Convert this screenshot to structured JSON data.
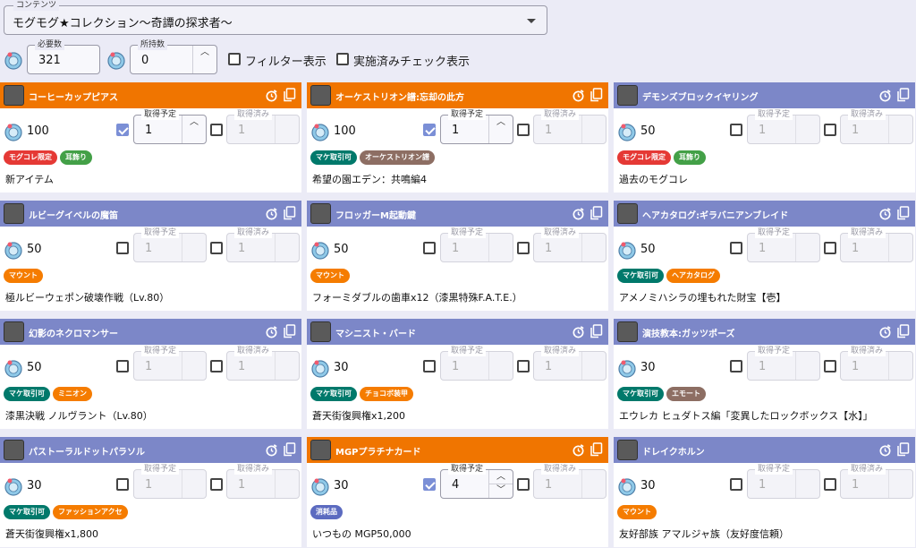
{
  "content_select": {
    "label": "コンテンツ",
    "value": "モグモグ★コレクション～奇譚の探求者～"
  },
  "filters": {
    "required": {
      "label": "必要数",
      "value": "321"
    },
    "owned": {
      "label": "所持数",
      "value": "0"
    },
    "filter_toggle_label": "フィルター表示",
    "done_toggle_label": "実施済みチェック表示"
  },
  "field_labels": {
    "planned": "取得予定",
    "done": "取得済み"
  },
  "colors": {
    "orange": "#f07500",
    "purple": "#7c87c8"
  },
  "tag_colors": {
    "モグコレ限定": "#e53935",
    "耳飾り": "#43a047",
    "マケ取引可": "#00796b",
    "オーケストリオン譜": "#8d6e63",
    "マウント": "#f57c00",
    "ヘアカタログ": "#f57c00",
    "ミニオン": "#f57c00",
    "チョコボ装甲": "#f57c00",
    "エモート": "#8d6e63",
    "ファッションアクセ": "#f57c00",
    "消耗品": "#5c6bc0"
  },
  "cards": [
    {
      "name": "コーヒーカップピアス",
      "color": "orange",
      "icon": "earring-icon",
      "cost": "100",
      "planned_checked": true,
      "planned": "1",
      "done": "1",
      "tags": [
        "モグコレ限定",
        "耳飾り"
      ],
      "source": "新アイテム"
    },
    {
      "name": "オーケストリオン譜:忘却の此方",
      "color": "orange",
      "icon": "orchestrion-roll-icon",
      "cost": "100",
      "planned_checked": true,
      "planned": "1",
      "done": "1",
      "tags": [
        "マケ取引可",
        "オーケストリオン譜"
      ],
      "source": "希望の園エデン：共鳴編4"
    },
    {
      "name": "デモンズブロックイヤリング",
      "color": "purple",
      "icon": "earring-icon",
      "cost": "50",
      "planned_checked": false,
      "planned": "1",
      "done": "1",
      "tags": [
        "モグコレ限定",
        "耳飾り"
      ],
      "source": "過去のモグコレ"
    },
    {
      "name": "ルビーグイベルの魔笛",
      "color": "purple",
      "icon": "mount-whistle-icon",
      "cost": "50",
      "planned_checked": false,
      "planned": "1",
      "done": "1",
      "tags": [
        "マウント"
      ],
      "source": "極ルビーウェポン破壊作戦（Lv.80）"
    },
    {
      "name": "フロッガーM起動鍵",
      "color": "purple",
      "icon": "mount-key-icon",
      "cost": "50",
      "planned_checked": false,
      "planned": "1",
      "done": "1",
      "tags": [
        "マウント"
      ],
      "source": "フォーミダブルの歯車x12（漆黒特殊F.A.T.E.）"
    },
    {
      "name": "ヘアカタログ:ギラバニアンブレイド",
      "color": "purple",
      "icon": "hair-catalog-icon",
      "cost": "50",
      "planned_checked": false,
      "planned": "1",
      "done": "1",
      "tags": [
        "マケ取引可",
        "ヘアカタログ"
      ],
      "source": "アメノミハシラの埋もれた財宝【壱】"
    },
    {
      "name": "幻影のネクロマンサー",
      "color": "purple",
      "icon": "minion-icon",
      "cost": "50",
      "planned_checked": false,
      "planned": "1",
      "done": "1",
      "tags": [
        "マケ取引可",
        "ミニオン"
      ],
      "source": "漆黒決戦 ノルヴラント（Lv.80）"
    },
    {
      "name": "マシニスト・バード",
      "color": "purple",
      "icon": "barding-icon",
      "cost": "30",
      "planned_checked": false,
      "planned": "1",
      "done": "1",
      "tags": [
        "マケ取引可",
        "チョコボ装甲"
      ],
      "source": "蒼天街復興権x1,200"
    },
    {
      "name": "演技教本:ガッツポーズ",
      "color": "purple",
      "icon": "emote-book-icon",
      "cost": "30",
      "planned_checked": false,
      "planned": "1",
      "done": "1",
      "tags": [
        "マケ取引可",
        "エモート"
      ],
      "source": "エウレカ ヒュダトス編「変異したロックボックス【水】」"
    },
    {
      "name": "パストーラルドットパラソル",
      "color": "purple",
      "icon": "parasol-icon",
      "cost": "30",
      "planned_checked": false,
      "planned": "1",
      "done": "1",
      "tags": [
        "マケ取引可",
        "ファッションアクセ"
      ],
      "source": "蒼天街復興権x1,800"
    },
    {
      "name": "MGPプラチナカード",
      "color": "orange",
      "icon": "mgp-card-icon",
      "cost": "30",
      "planned_checked": true,
      "planned": "4",
      "done": "1",
      "tags": [
        "消耗品"
      ],
      "source": "いつもの MGP50,000"
    },
    {
      "name": "ドレイクホルン",
      "color": "purple",
      "icon": "horn-icon",
      "cost": "30",
      "planned_checked": false,
      "planned": "1",
      "done": "1",
      "tags": [
        "マウント"
      ],
      "source": "友好部族 アマルジャ族（友好度信頼）"
    }
  ]
}
